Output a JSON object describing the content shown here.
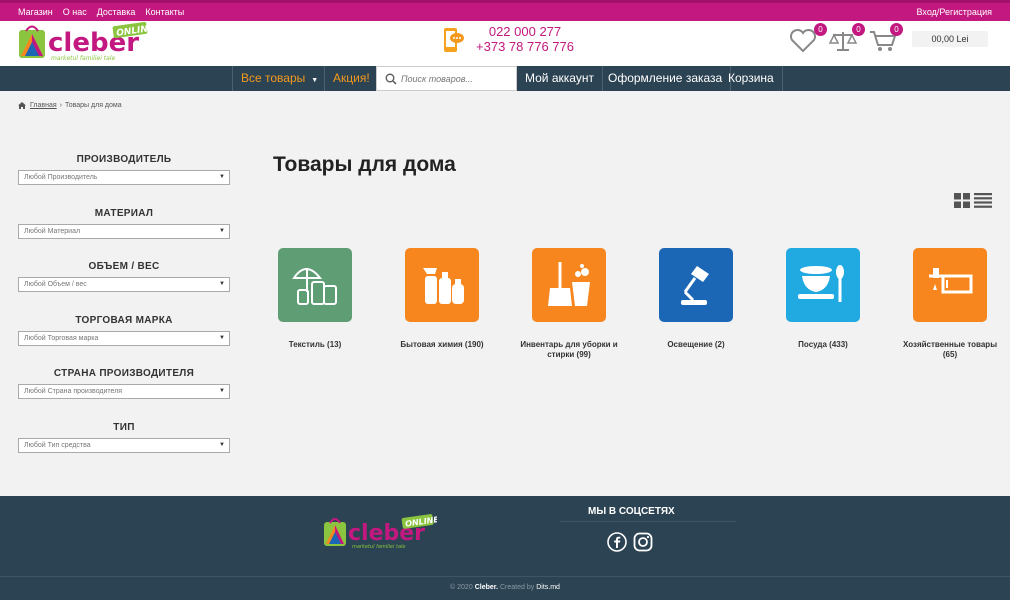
{
  "topbar": {
    "links": [
      "Магазин",
      "О нас",
      "Доставка",
      "Контакты"
    ],
    "login": "Вход/Регистрация"
  },
  "header": {
    "phone1": "022 000 277",
    "phone2": "+373 78 776 776",
    "wishlist_count": "0",
    "compare_count": "0",
    "cart_count": "0",
    "cart_total": "00,00 Lei"
  },
  "nav": {
    "all_products": "Все товары",
    "sale": "Акция!",
    "search_placeholder": "Поиск товаров...",
    "account": "Мой аккаунт",
    "checkout": "Оформление заказа",
    "cart": "Корзина"
  },
  "breadcrumb": {
    "home": "Главная",
    "current": "Товары для дома"
  },
  "filters": [
    {
      "title": "ПРОИЗВОДИТЕЛЬ",
      "value": "Любой Производитель"
    },
    {
      "title": "МАТЕРИАЛ",
      "value": "Любой Материал"
    },
    {
      "title": "ОБЪЕМ / ВЕС",
      "value": "Любой Объем / вес"
    },
    {
      "title": "ТОРГОВАЯ МАРКА",
      "value": "Любой Торговая марка"
    },
    {
      "title": "СТРАНА ПРОИЗВОДИТЕЛЯ",
      "value": "Любой Страна производителя"
    },
    {
      "title": "ТИП",
      "value": "Любой Тип средства"
    }
  ],
  "page_title": "Товары для дома",
  "categories": [
    {
      "label": "Текстиль (13)",
      "color": "#5f9e74",
      "icon": "textile-icon"
    },
    {
      "label": "Бытовая химия (190)",
      "color": "#f7861e",
      "icon": "household-chemicals-icon"
    },
    {
      "label": "Инвентарь для уборки и стирки (99)",
      "color": "#f7861e",
      "icon": "cleaning-tools-icon"
    },
    {
      "label": "Освещение (2)",
      "color": "#1b66b5",
      "icon": "lamp-icon"
    },
    {
      "label": "Посуда (433)",
      "color": "#21a9e1",
      "icon": "dishes-icon"
    },
    {
      "label": "Хозяйственные товары (65)",
      "color": "#f7861e",
      "icon": "household-goods-icon"
    }
  ],
  "footer": {
    "social_title": "МЫ В СОЦСЕТЯХ",
    "copy_prefix": "© 2020",
    "brand": "Cleber.",
    "created_by": "Created by",
    "dev": "Dits.md"
  },
  "colors": {
    "brand": "#c2187f",
    "nav": "#2c4353",
    "accent": "#f39a1e"
  }
}
